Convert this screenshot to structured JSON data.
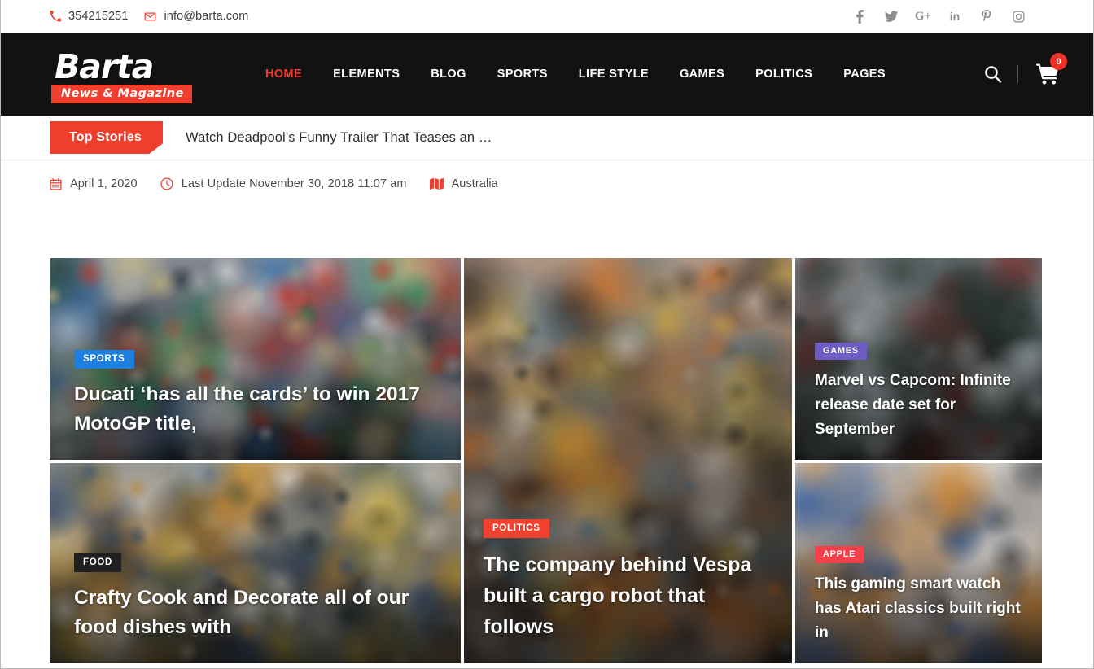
{
  "topbar": {
    "phone": "354215251",
    "email": "info@barta.com",
    "socials": [
      {
        "name": "facebook-icon",
        "label": "f"
      },
      {
        "name": "twitter-icon",
        "label": "t"
      },
      {
        "name": "google-plus-icon",
        "label": "G+"
      },
      {
        "name": "linkedin-icon",
        "label": "in"
      },
      {
        "name": "pinterest-icon",
        "label": "p"
      },
      {
        "name": "instagram-icon",
        "label": "ig"
      }
    ]
  },
  "header": {
    "logo_main": "Barta",
    "logo_sub": "News & Magazine",
    "nav": [
      {
        "label": "HOME",
        "active": true
      },
      {
        "label": "ELEMENTS",
        "active": false
      },
      {
        "label": "BLOG",
        "active": false
      },
      {
        "label": "SPORTS",
        "active": false
      },
      {
        "label": "LIFE STYLE",
        "active": false
      },
      {
        "label": "GAMES",
        "active": false
      },
      {
        "label": "POLITICS",
        "active": false
      },
      {
        "label": "PAGES",
        "active": false
      }
    ],
    "cart_count": "0",
    "accent_color": "#f0392b"
  },
  "ticker": {
    "badge": "Top Stories",
    "headline": "Watch Deadpool’s Funny Trailer That Teases an …"
  },
  "meta": {
    "date": "April 1, 2020",
    "last_update": "Last Update November 30, 2018 11:07 am",
    "location": "Australia"
  },
  "cards": [
    {
      "id": "ducati",
      "category": "SPORTS",
      "category_color": "#1d7fe0",
      "title": "Ducati ‘has all the cards’ to win 2017 MotoGP title,",
      "image": "cycling-race-peloton"
    },
    {
      "id": "vespa",
      "category": "POLITICS",
      "category_color": "#f2402f",
      "title": "The company behind Vespa built a cargo robot that follows",
      "image": "woman-photographer-protest-crowd"
    },
    {
      "id": "marvel",
      "category": "GAMES",
      "category_color": "#6c5cc4",
      "title": "Marvel vs Capcom: Infinite release date set for September",
      "image": "offroad-truck-rally-mud"
    },
    {
      "id": "crafty-cook",
      "category": "FOOD",
      "category_color": "#1f1f1f",
      "title": "Crafty Cook and Decorate all of our food dishes with",
      "image": "burger-and-fries-plate"
    },
    {
      "id": "atari-watch",
      "category": "APPLE",
      "category_color": "#f4404a",
      "title": "This gaming smart watch has Atari classics built right in",
      "image": "hand-holding-smartphone"
    }
  ]
}
